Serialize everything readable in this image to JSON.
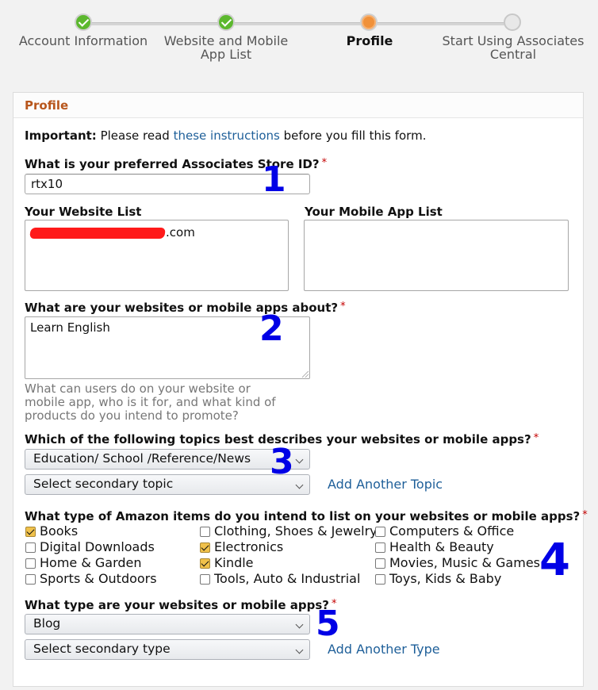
{
  "steps": [
    {
      "label": "Account Information",
      "state": "done"
    },
    {
      "label": "Website and Mobile App List",
      "state": "done"
    },
    {
      "label": "Profile",
      "state": "current"
    },
    {
      "label": "Start Using Associates Central",
      "state": "pending"
    }
  ],
  "card": {
    "title": "Profile",
    "important_prefix": "Important:",
    "important_before": "Please read",
    "important_link": "these instructions",
    "important_after": "before you fill this form."
  },
  "store_id": {
    "question": "What is your preferred Associates Store ID?",
    "required_mark": "*",
    "value": "rtx10"
  },
  "website_list": {
    "label": "Your Website List",
    "value_suffix": ".com"
  },
  "mobile_app_list": {
    "label": "Your Mobile App List",
    "value": ""
  },
  "about": {
    "question": "What are your websites or mobile apps about?",
    "required_mark": "*",
    "value": "Learn English",
    "hint": "What can users do on your website or mobile app, who is it for, and what kind of products do you intend to promote?"
  },
  "topics": {
    "question": "Which of the following topics best describes your websites or mobile apps?",
    "required_mark": "*",
    "primary_value": "Education/ School /Reference/News",
    "secondary_placeholder": "Select secondary topic",
    "add_link": "Add Another Topic"
  },
  "items": {
    "question": "What type of Amazon items do you intend to list on your websites or mobile apps?",
    "required_mark": "*",
    "checkbox_fill": "#f0c14b",
    "options": [
      {
        "label": "Books",
        "checked": true
      },
      {
        "label": "Clothing, Shoes & Jewelry",
        "checked": false
      },
      {
        "label": "Computers & Office",
        "checked": false
      },
      {
        "label": "Digital Downloads",
        "checked": false
      },
      {
        "label": "Electronics",
        "checked": true
      },
      {
        "label": "Health & Beauty",
        "checked": false
      },
      {
        "label": "Home & Garden",
        "checked": false
      },
      {
        "label": "Kindle",
        "checked": true
      },
      {
        "label": "Movies, Music & Games",
        "checked": false
      },
      {
        "label": "Sports & Outdoors",
        "checked": false
      },
      {
        "label": "Tools, Auto & Industrial",
        "checked": false
      },
      {
        "label": "Toys, Kids & Baby",
        "checked": false
      }
    ]
  },
  "site_type": {
    "question": "What type are your websites or mobile apps?",
    "required_mark": "*",
    "primary_value": "Blog",
    "secondary_placeholder": "Select secondary type",
    "add_link": "Add Another Type"
  },
  "annotations": [
    "1",
    "2",
    "3",
    "4",
    "5"
  ],
  "colors": {
    "accent_orange": "#b8561c",
    "link_blue": "#1e5f99",
    "annotation_blue": "#0000e6",
    "step_done_green": "#5cb82e",
    "step_current_orange": "#f0913a",
    "redaction_red": "#ff1a1a"
  }
}
